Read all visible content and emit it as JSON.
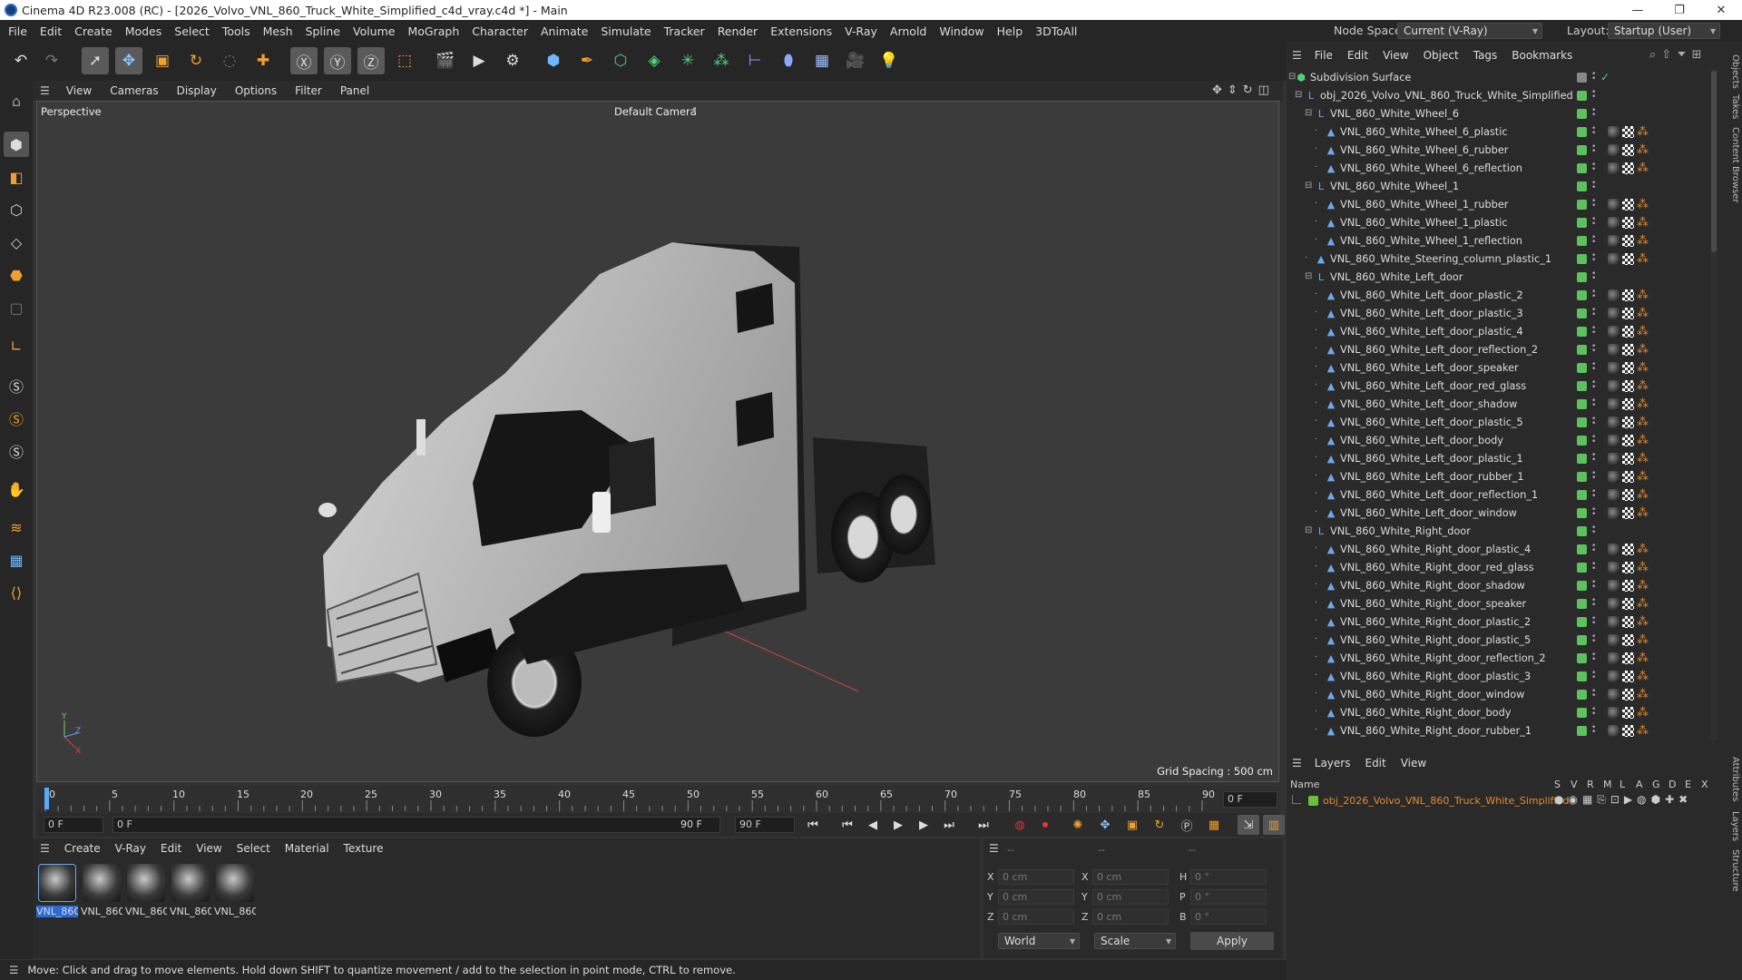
{
  "window": {
    "title": "Cinema 4D R23.008 (RC) - [2026_Volvo_VNL_860_Truck_White_Simplified_c4d_vray.c4d *] - Main",
    "minimize": "—",
    "maximize": "❐",
    "close": "✕"
  },
  "menu": [
    "File",
    "Edit",
    "Create",
    "Modes",
    "Select",
    "Tools",
    "Mesh",
    "Spline",
    "Volume",
    "MoGraph",
    "Character",
    "Animate",
    "Simulate",
    "Tracker",
    "Render",
    "Extensions",
    "V-Ray",
    "Arnold",
    "Window",
    "Help",
    "3DToAll"
  ],
  "node_space": {
    "label": "Node Space:",
    "value": "Current (V-Ray)"
  },
  "layout": {
    "label": "Layout:",
    "value": "Startup (User)"
  },
  "viewport": {
    "menu": [
      "View",
      "Cameras",
      "Display",
      "Options",
      "Filter",
      "Panel"
    ],
    "name": "Perspective",
    "camera": "Default Camera",
    "grid_spacing": "Grid Spacing : 500 cm"
  },
  "timeline": {
    "ticks": [
      "0",
      "5",
      "10",
      "15",
      "20",
      "25",
      "30",
      "35",
      "40",
      "45",
      "50",
      "55",
      "60",
      "65",
      "70",
      "75",
      "80",
      "85",
      "90"
    ],
    "current_frame": "0 F",
    "start": "0 F",
    "range_start": "0 F",
    "range_end": "90 F",
    "end": "90 F"
  },
  "material_panel": {
    "menu": [
      "Create",
      "V-Ray",
      "Edit",
      "View",
      "Select",
      "Material",
      "Texture"
    ],
    "materials": [
      "VNL_860",
      "VNL_860",
      "VNL_860",
      "VNL_860",
      "VNL_860"
    ]
  },
  "attributes": {
    "header": [
      "--",
      "--",
      "--"
    ],
    "rows": [
      {
        "a": "X",
        "av": "0 cm",
        "b": "X",
        "bv": "0 cm",
        "c": "H",
        "cv": "0 °"
      },
      {
        "a": "Y",
        "av": "0 cm",
        "b": "Y",
        "bv": "0 cm",
        "c": "P",
        "cv": "0 °"
      },
      {
        "a": "Z",
        "av": "0 cm",
        "b": "Z",
        "bv": "0 cm",
        "c": "B",
        "cv": "0 °"
      }
    ],
    "world": "World",
    "scale": "Scale",
    "apply": "Apply"
  },
  "status": "Move: Click and drag to move elements. Hold down SHIFT to quantize movement / add to the selection in point mode, CTRL to remove.",
  "object_manager": {
    "menu": [
      "File",
      "Edit",
      "View",
      "Object",
      "Tags",
      "Bookmarks"
    ],
    "objects": [
      {
        "name": "Subdivision Surface",
        "level": 0,
        "tags": false
      },
      {
        "name": "obj_2026_Volvo_VNL_860_Truck_White_Simplified",
        "level": 1,
        "tags": false
      },
      {
        "name": "VNL_860_White_Wheel_6",
        "level": 2,
        "tags": false
      },
      {
        "name": "VNL_860_White_Wheel_6_plastic",
        "level": 3,
        "tags": true
      },
      {
        "name": "VNL_860_White_Wheel_6_rubber",
        "level": 3,
        "tags": true
      },
      {
        "name": "VNL_860_White_Wheel_6_reflection",
        "level": 3,
        "tags": true
      },
      {
        "name": "VNL_860_White_Wheel_1",
        "level": 2,
        "tags": false
      },
      {
        "name": "VNL_860_White_Wheel_1_rubber",
        "level": 3,
        "tags": true
      },
      {
        "name": "VNL_860_White_Wheel_1_plastic",
        "level": 3,
        "tags": true
      },
      {
        "name": "VNL_860_White_Wheel_1_reflection",
        "level": 3,
        "tags": true
      },
      {
        "name": "VNL_860_White_Steering_column_plastic_1",
        "level": 2,
        "tags": true
      },
      {
        "name": "VNL_860_White_Left_door",
        "level": 2,
        "tags": false
      },
      {
        "name": "VNL_860_White_Left_door_plastic_2",
        "level": 3,
        "tags": true
      },
      {
        "name": "VNL_860_White_Left_door_plastic_3",
        "level": 3,
        "tags": true
      },
      {
        "name": "VNL_860_White_Left_door_plastic_4",
        "level": 3,
        "tags": true
      },
      {
        "name": "VNL_860_White_Left_door_reflection_2",
        "level": 3,
        "tags": true
      },
      {
        "name": "VNL_860_White_Left_door_speaker",
        "level": 3,
        "tags": true
      },
      {
        "name": "VNL_860_White_Left_door_red_glass",
        "level": 3,
        "tags": true
      },
      {
        "name": "VNL_860_White_Left_door_shadow",
        "level": 3,
        "tags": true
      },
      {
        "name": "VNL_860_White_Left_door_plastic_5",
        "level": 3,
        "tags": true
      },
      {
        "name": "VNL_860_White_Left_door_body",
        "level": 3,
        "tags": true
      },
      {
        "name": "VNL_860_White_Left_door_plastic_1",
        "level": 3,
        "tags": true
      },
      {
        "name": "VNL_860_White_Left_door_rubber_1",
        "level": 3,
        "tags": true
      },
      {
        "name": "VNL_860_White_Left_door_reflection_1",
        "level": 3,
        "tags": true
      },
      {
        "name": "VNL_860_White_Left_door_window",
        "level": 3,
        "tags": true
      },
      {
        "name": "VNL_860_White_Right_door",
        "level": 2,
        "tags": false
      },
      {
        "name": "VNL_860_White_Right_door_plastic_4",
        "level": 3,
        "tags": true
      },
      {
        "name": "VNL_860_White_Right_door_red_glass",
        "level": 3,
        "tags": true
      },
      {
        "name": "VNL_860_White_Right_door_shadow",
        "level": 3,
        "tags": true
      },
      {
        "name": "VNL_860_White_Right_door_speaker",
        "level": 3,
        "tags": true
      },
      {
        "name": "VNL_860_White_Right_door_plastic_2",
        "level": 3,
        "tags": true
      },
      {
        "name": "VNL_860_White_Right_door_plastic_5",
        "level": 3,
        "tags": true
      },
      {
        "name": "VNL_860_White_Right_door_reflection_2",
        "level": 3,
        "tags": true
      },
      {
        "name": "VNL_860_White_Right_door_plastic_3",
        "level": 3,
        "tags": true
      },
      {
        "name": "VNL_860_White_Right_door_window",
        "level": 3,
        "tags": true
      },
      {
        "name": "VNL_860_White_Right_door_body",
        "level": 3,
        "tags": true
      },
      {
        "name": "VNL_860_White_Right_door_rubber_1",
        "level": 3,
        "tags": true
      }
    ]
  },
  "layers": {
    "menu": [
      "Layers",
      "Edit",
      "View"
    ],
    "name_header": "Name",
    "flags": [
      "S",
      "V",
      "R",
      "M",
      "L",
      "A",
      "G",
      "D",
      "E",
      "X"
    ],
    "items": [
      "obj_2026_Volvo_VNL_860_Truck_White_Simplified"
    ]
  },
  "side_tabs": [
    "Objects",
    "Takes",
    "Content Browser",
    "Attributes",
    "Layers",
    "Structure"
  ],
  "colors": {
    "accent": "#2b6bd2",
    "layer_orange": "#e88a2a",
    "tag_green": "#5cc25c"
  }
}
